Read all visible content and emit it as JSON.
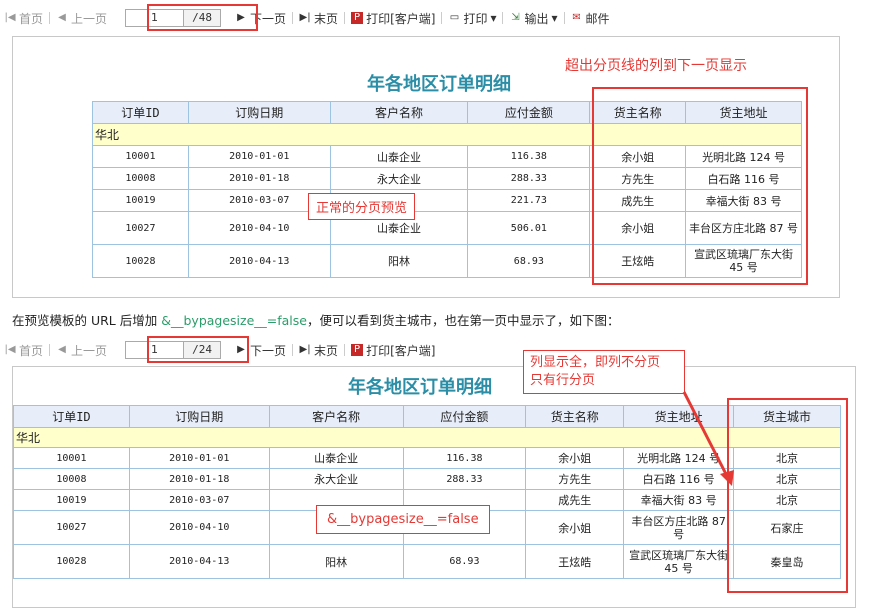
{
  "toolbar1": {
    "first": "首页",
    "prev": "上一页",
    "page": "1",
    "total": "/48",
    "next": "下一页",
    "last": "末页",
    "print_client": "打印[客户端]",
    "print": "打印",
    "export": "输出",
    "mail": "邮件"
  },
  "toolbar2": {
    "first": "首页",
    "prev": "上一页",
    "page": "1",
    "total": "/24",
    "next": "下一页",
    "last": "末页",
    "print_client": "打印[客户端]"
  },
  "report1": {
    "title": "年各地区订单明细",
    "note": "超出分页线的列到下一页显示",
    "callout": "正常的分页预览",
    "headers": [
      "订单ID",
      "订购日期",
      "客户名称",
      "应付金额",
      "货主名称",
      "货主地址"
    ],
    "group": "华北",
    "rows": [
      [
        "10001",
        "2010-01-01",
        "山泰企业",
        "116.38",
        "余小姐",
        "光明北路 124 号"
      ],
      [
        "10008",
        "2010-01-18",
        "永大企业",
        "288.33",
        "方先生",
        "白石路 116 号"
      ],
      [
        "10019",
        "2010-03-07",
        "",
        "221.73",
        "成先生",
        "幸福大街 83 号"
      ],
      [
        "10027",
        "2010-04-10",
        "山泰企业",
        "506.01",
        "余小姐",
        "丰台区方庄北路 87 号"
      ],
      [
        "10028",
        "2010-04-13",
        "阳林",
        "68.93",
        "王炫皓",
        "宣武区琉璃厂东大街 45 号"
      ]
    ]
  },
  "paragraph": {
    "before": "在预览模板的 URL 后增加 ",
    "param": "&__bypagesize__=false",
    "after": "，便可以看到货主城市，也在第一页中显示了，如下图："
  },
  "report2": {
    "title": "年各地区订单明细",
    "callout_top": "列显示全，即列不分页",
    "callout_bottom": "只有行分页",
    "callout_param": "&__bypagesize__=false",
    "headers": [
      "订单ID",
      "订购日期",
      "客户名称",
      "应付金额",
      "货主名称",
      "货主地址",
      "货主城市"
    ],
    "group": "华北",
    "rows": [
      [
        "10001",
        "2010-01-01",
        "山泰企业",
        "116.38",
        "余小姐",
        "光明北路 124 号",
        "北京"
      ],
      [
        "10008",
        "2010-01-18",
        "永大企业",
        "288.33",
        "方先生",
        "白石路 116 号",
        "北京"
      ],
      [
        "10019",
        "2010-03-07",
        "",
        "",
        "成先生",
        "幸福大街 83 号",
        "北京"
      ],
      [
        "10027",
        "2010-04-10",
        "",
        "",
        "余小姐",
        "丰台区方庄北路 87 号",
        "石家庄"
      ],
      [
        "10028",
        "2010-04-13",
        "阳林",
        "68.93",
        "王炫皓",
        "宣武区琉璃厂东大街 45 号",
        "秦皇岛"
      ]
    ]
  },
  "colors": {
    "accent": "#e53935",
    "title": "#2b8ea6",
    "header_bg": "#e8eef9",
    "group_bg": "#ffffcc",
    "param": "#2b9c6a"
  }
}
